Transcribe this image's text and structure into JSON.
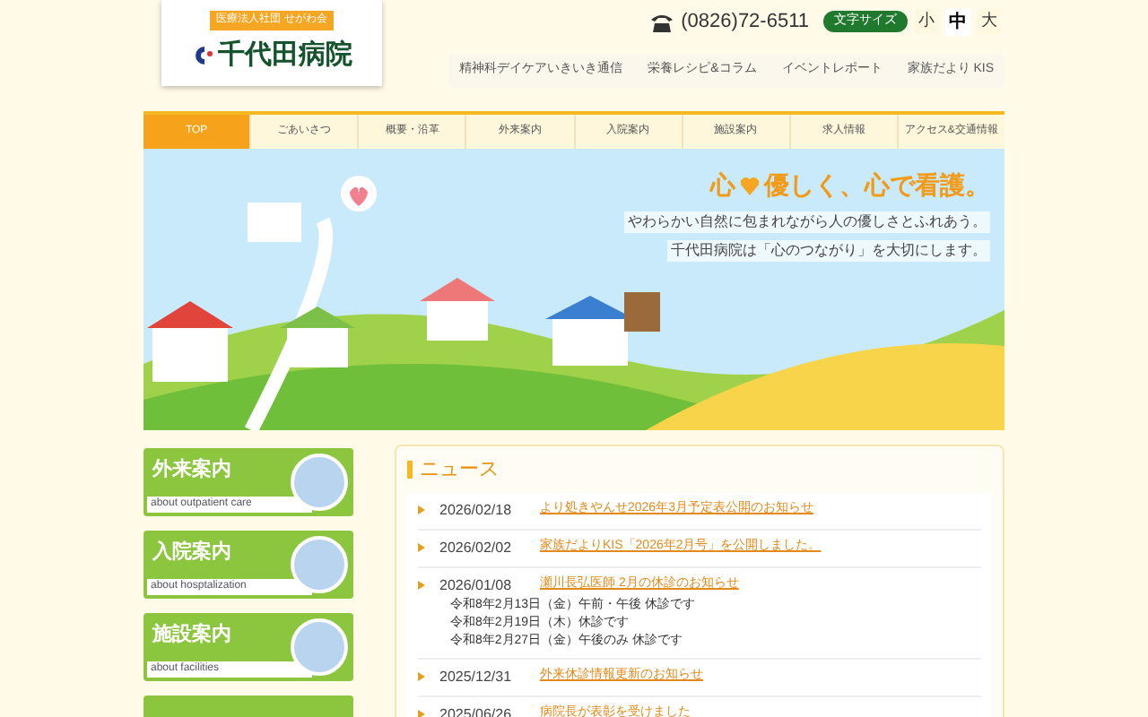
{
  "header": {
    "org_badge": "医療法人社団 せがわ会",
    "logo_text": "千代田病院",
    "phone": "(0826)72-6511",
    "font_size_label": "文字サイズ",
    "font_sizes": [
      {
        "label": "小",
        "selected": false
      },
      {
        "label": "中",
        "selected": true
      },
      {
        "label": "大",
        "selected": false
      }
    ],
    "links": [
      "精神科デイケアいきいき通信",
      "栄養レシピ&コラム",
      "イベントレポート",
      "家族だより KIS"
    ]
  },
  "nav": [
    {
      "label": "TOP",
      "selected": true
    },
    {
      "label": "ごあいさつ",
      "selected": false
    },
    {
      "label": "概要・沿革",
      "selected": false
    },
    {
      "label": "外来案内",
      "selected": false
    },
    {
      "label": "入院案内",
      "selected": false
    },
    {
      "label": "施設案内",
      "selected": false
    },
    {
      "label": "求人情報",
      "selected": false
    },
    {
      "label": "アクセス&交通情報",
      "selected": false
    }
  ],
  "hero": {
    "heading_start": "心",
    "heading_end": "優しく、心で看護。",
    "lines": [
      "やわらかい自然に包まれながら人の優しさとふれあう。",
      "千代田病院は「心のつながり」を大切にします。"
    ]
  },
  "sidebar": [
    {
      "title": "外来案内",
      "subtitle": "about outpatient care"
    },
    {
      "title": "入院案内",
      "subtitle": "about hosptalization"
    },
    {
      "title": "施設案内",
      "subtitle": "about facilities"
    }
  ],
  "news": {
    "title": "ニュース",
    "items": [
      {
        "date": "2026/02/18",
        "title": "より処きやんせ2026年3月予定表公開のお知らせ"
      },
      {
        "date": "2026/02/02",
        "title": "家族だよりKIS「2026年2月号」を公開しました。"
      },
      {
        "date": "2026/01/08",
        "title": "瀬川長弘医師 2月の休診のお知らせ",
        "details": [
          "令和8年2月13日（金）午前・午後 休診です",
          "令和8年2月19日（木）休診です",
          "令和8年2月27日（金）午後のみ 休診です"
        ]
      },
      {
        "date": "2025/12/31",
        "title": "外来休診情報更新のお知らせ"
      },
      {
        "date": "2025/06/26",
        "title": "病院長が表彰を受けました"
      }
    ]
  }
}
